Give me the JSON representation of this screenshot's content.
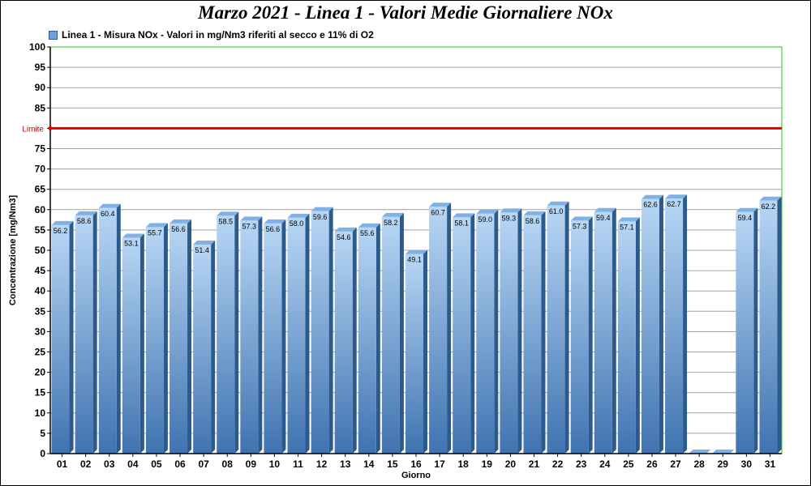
{
  "chart_data": {
    "type": "bar",
    "title": "Marzo 2021 - Linea 1 - Valori Medie Giornaliere NOx",
    "xlabel": "Giorno",
    "ylabel": "Concentrazione [mg/Nm3]",
    "ylim": [
      0,
      100
    ],
    "ytick_step": 5,
    "grid": true,
    "legend_position": "top-left",
    "categories": [
      "01",
      "02",
      "03",
      "04",
      "05",
      "06",
      "07",
      "08",
      "09",
      "10",
      "11",
      "12",
      "13",
      "14",
      "15",
      "16",
      "17",
      "18",
      "19",
      "20",
      "21",
      "22",
      "23",
      "24",
      "25",
      "26",
      "27",
      "28",
      "29",
      "30",
      "31"
    ],
    "series": [
      {
        "name": "Linea 1 - Misura NOx - Valori in mg/Nm3 riferiti al secco e 11% di O2",
        "values": [
          56.2,
          58.6,
          60.4,
          53.1,
          55.7,
          56.6,
          51.4,
          58.5,
          57.3,
          56.6,
          58.0,
          59.6,
          54.6,
          55.6,
          58.2,
          49.1,
          60.7,
          58.1,
          59.0,
          59.3,
          58.6,
          61.0,
          57.3,
          59.4,
          57.1,
          62.6,
          62.7,
          null,
          null,
          59.4,
          62.2
        ],
        "labels": [
          "56.2",
          "58.6",
          "60.4",
          "53.1",
          "55.7",
          "56.6",
          "51.4",
          "58.5",
          "57.3",
          "56.6",
          "58.0",
          "59.6",
          "54.6",
          "55.6",
          "58.2",
          "49.1",
          "60.7",
          "58.1",
          "59.0",
          "59.3",
          "58.6",
          "61.0",
          "57.3",
          "59.4",
          "57.1",
          "62.6",
          "62.7",
          "",
          "",
          "59.4",
          "62.2"
        ],
        "color": "#6d9fd8"
      }
    ],
    "limit": {
      "label": "Limite",
      "value": 80,
      "color": "#e00000"
    },
    "colors": {
      "plot_border": "#22c022",
      "grid": "#a0a0a0",
      "bar_top": "#b8d7f5",
      "bar_bottom": "#3f73b0",
      "bar_side": "#2c5a8c",
      "bar_cap": "#7fb0e6"
    }
  }
}
